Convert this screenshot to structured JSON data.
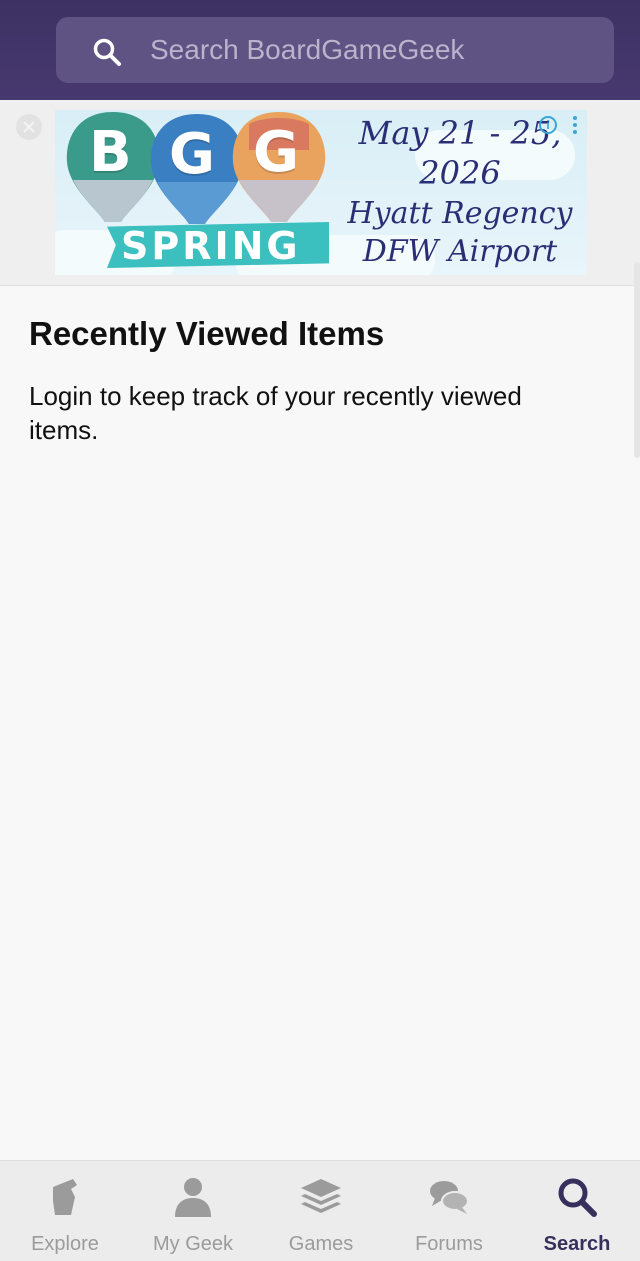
{
  "header": {
    "search": {
      "placeholder": "Search BoardGameGeek",
      "icon": "search-icon"
    }
  },
  "ad": {
    "letters": [
      "B",
      "G",
      "G"
    ],
    "ribbon": "SPRING",
    "date_line1": "May 21 - 25,",
    "date_line2": "2026",
    "venue_line1": "Hyatt Regency",
    "venue_line2": "DFW Airport",
    "info_symbol": "i"
  },
  "recent": {
    "title": "Recently Viewed Items",
    "message": "Login to keep track of your recently viewed items."
  },
  "bottom_nav": {
    "items": [
      {
        "label": "Explore",
        "icon": "explore-icon"
      },
      {
        "label": "My Geek",
        "icon": "person-icon"
      },
      {
        "label": "Games",
        "icon": "layers-icon"
      },
      {
        "label": "Forums",
        "icon": "chat-bubbles-icon"
      },
      {
        "label": "Search",
        "icon": "search-icon"
      }
    ],
    "active_index": 4
  },
  "colors": {
    "header_bg": "#3d3163",
    "search_bg": "#5f5383",
    "active_nav": "#38305c",
    "inactive_nav": "#9b9b9b"
  }
}
